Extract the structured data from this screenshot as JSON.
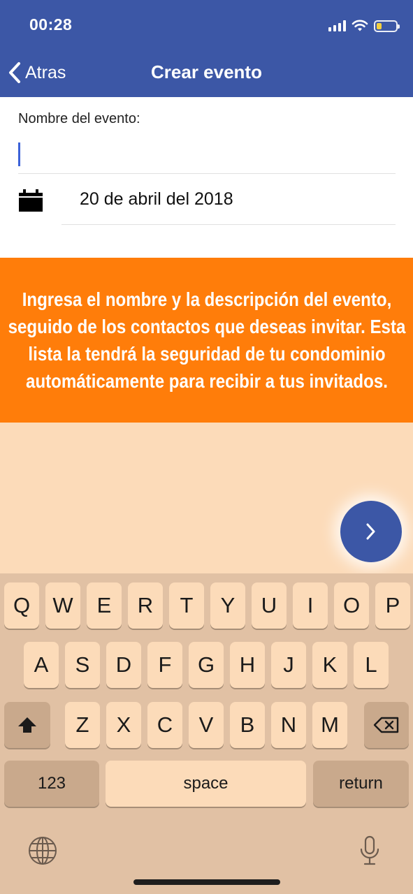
{
  "status_bar": {
    "time": "00:28",
    "battery_level": 0.25,
    "battery_color": "#f4d03f"
  },
  "nav": {
    "back_label": "Atras",
    "title": "Crear evento",
    "color": "#3c57a6"
  },
  "form": {
    "name_label": "Nombre del evento:",
    "name_value": "",
    "date_value": "20 de abril del 2018"
  },
  "banner": {
    "text": "Ingresa el nombre y la descripción del evento, seguido de los contactos que deseas invitar. Esta lista la tendrá la seguridad de tu condominio automáticamente para recibir a tus invitados.",
    "color": "#ff7d0a"
  },
  "fab": {
    "icon": "chevron-right-icon"
  },
  "keyboard": {
    "row1": [
      "Q",
      "W",
      "E",
      "R",
      "T",
      "Y",
      "U",
      "I",
      "O",
      "P"
    ],
    "row2": [
      "A",
      "S",
      "D",
      "F",
      "G",
      "H",
      "J",
      "K",
      "L"
    ],
    "row3": [
      "Z",
      "X",
      "C",
      "V",
      "B",
      "N",
      "M"
    ],
    "numbers_label": "123",
    "space_label": "space",
    "return_label": "return",
    "shift_icon": "shift-icon",
    "delete_icon": "delete-icon",
    "globe_icon": "globe-icon",
    "mic_icon": "microphone-icon"
  }
}
